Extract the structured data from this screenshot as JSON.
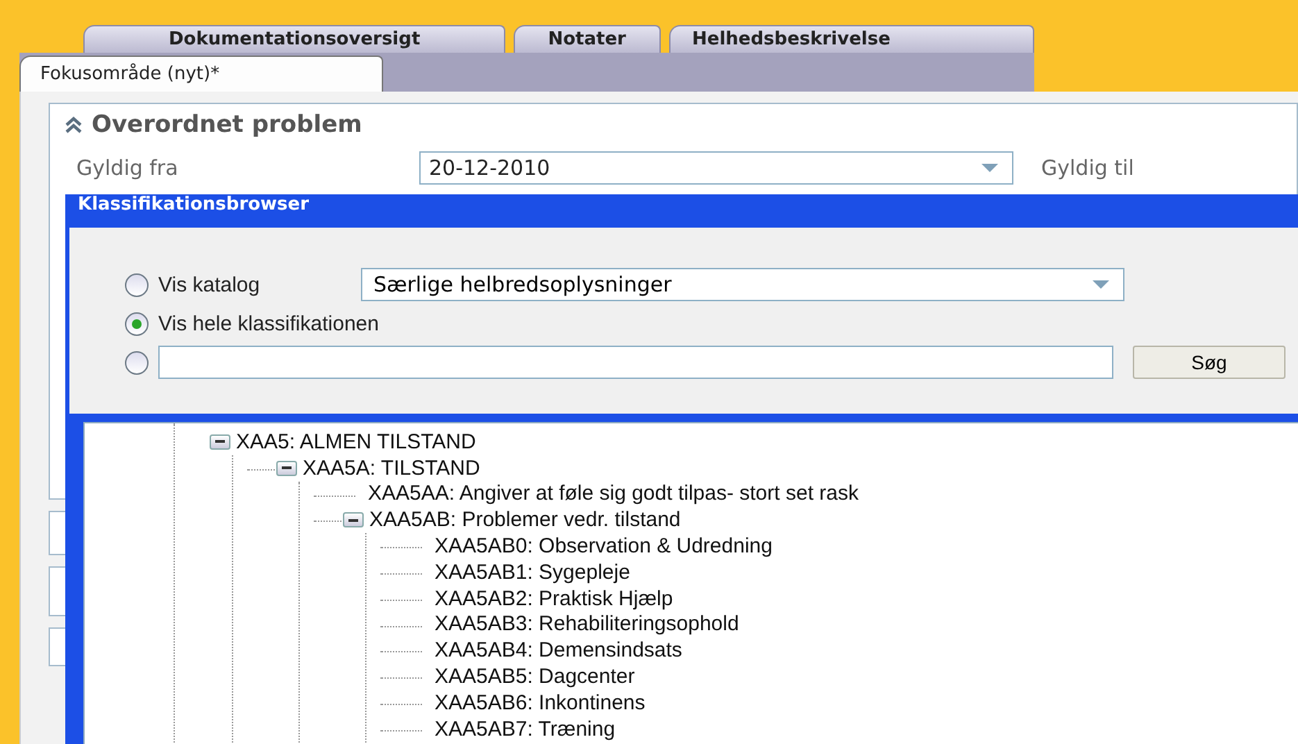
{
  "tab_rows": [
    [
      {
        "label": "Dokumentationsoversigt",
        "selected": false
      },
      {
        "label": "Notater",
        "selected": false
      },
      {
        "label": "Helhedsbeskrivelse",
        "selected": false
      }
    ],
    [
      {
        "label": "Fokusområde (nyt)*",
        "selected": true
      }
    ]
  ],
  "panel": {
    "title": "Overordnet problem",
    "expanded": true,
    "from_label": "Gyldig fra",
    "from_value": "20-12-2010",
    "to_label": "Gyldig til"
  },
  "dialog": {
    "title": "Klassifikationsbrowser",
    "options": [
      {
        "kind": "dropdown",
        "label": "Vis katalog",
        "selected": false,
        "value": "Særlige helbredsoplysninger"
      },
      {
        "kind": "plain",
        "label": "Vis hele klassifikationen",
        "selected": true
      },
      {
        "kind": "search",
        "selected": false,
        "button": "Søg"
      }
    ],
    "tree": [
      {
        "label": "XAA5: ALMEN TILSTAND",
        "expanded": true,
        "children": [
          {
            "label": "XAA5A: TILSTAND",
            "expanded": true,
            "children": [
              {
                "label": "XAA5AA: Angiver at føle sig godt tilpas- stort set rask"
              },
              {
                "label": "XAA5AB: Problemer vedr. tilstand",
                "expanded": true,
                "children": [
                  {
                    "label": "XAA5AB0: Observation & Udredning"
                  },
                  {
                    "label": "XAA5AB1: Sygepleje"
                  },
                  {
                    "label": "XAA5AB2: Praktisk Hjælp"
                  },
                  {
                    "label": "XAA5AB3: Rehabiliteringsophold"
                  },
                  {
                    "label": "XAA5AB4: Demensindsats"
                  },
                  {
                    "label": "XAA5AB5: Dagcenter"
                  },
                  {
                    "label": "XAA5AB6: Inkontinens"
                  },
                  {
                    "label": "XAA5AB7: Træning"
                  }
                ]
              }
            ]
          }
        ]
      }
    ]
  }
}
